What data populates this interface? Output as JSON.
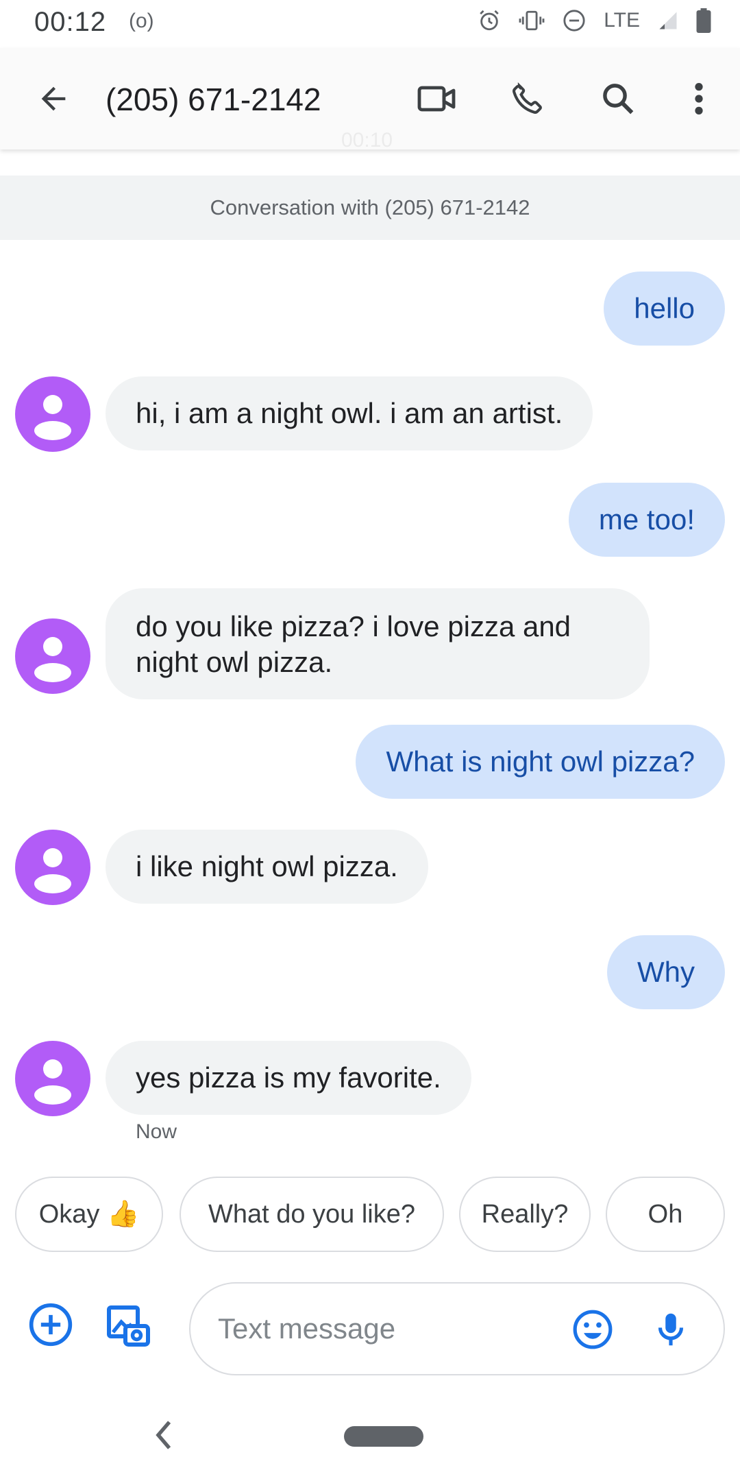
{
  "status_bar": {
    "time": "00:12",
    "cast_glyph": "(o)",
    "network": "LTE",
    "icons": [
      "alarm-icon",
      "vibrate-icon",
      "do-not-disturb-icon",
      "signal-icon",
      "battery-icon"
    ]
  },
  "app_bar": {
    "title": "(205) 671-2142",
    "ghost_time": "00:10",
    "icons": [
      "arrow-back-icon",
      "video-call-icon",
      "phone-icon",
      "search-icon",
      "more-vert-icon"
    ]
  },
  "conversation_header": "Conversation with (205) 671-2142",
  "messages": [
    {
      "direction": "outgoing",
      "text": "hello"
    },
    {
      "direction": "incoming",
      "text": "hi, i am a night owl. i am an artist."
    },
    {
      "direction": "outgoing",
      "text": "me too!"
    },
    {
      "direction": "incoming",
      "text": "do you like pizza? i love pizza and night owl pizza."
    },
    {
      "direction": "outgoing",
      "text": "What is night owl pizza?"
    },
    {
      "direction": "incoming",
      "text": "i like night owl pizza."
    },
    {
      "direction": "outgoing",
      "text": "Why"
    },
    {
      "direction": "incoming",
      "text": "yes pizza is my favorite."
    }
  ],
  "last_message_time": "Now",
  "suggestions": [
    "Okay 👍",
    "What do you like?",
    "Really?",
    "Oh"
  ],
  "compose": {
    "placeholder": "Text message",
    "icons": [
      "add-circle-icon",
      "gallery-camera-icon",
      "emoji-icon",
      "mic-icon"
    ]
  },
  "colors": {
    "accent": "#1a73e8",
    "outgoing_bubble": "#d2e3fc",
    "outgoing_text": "#174ea6",
    "incoming_bubble": "#f1f3f4",
    "avatar": "#b25cf7"
  }
}
